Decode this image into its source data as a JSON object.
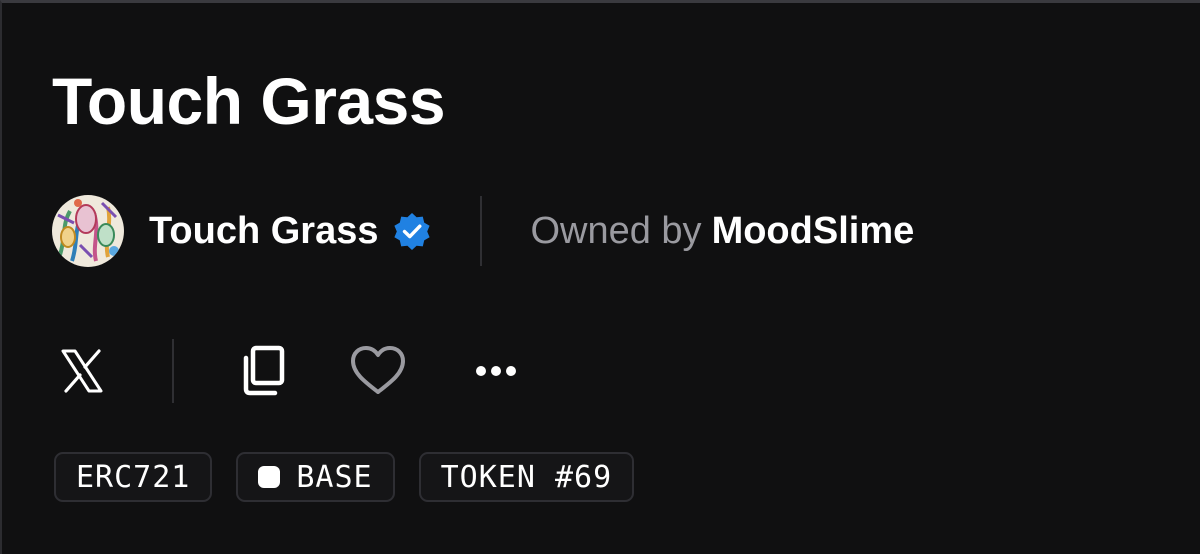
{
  "page": {
    "title": "Touch Grass"
  },
  "collection": {
    "name": "Touch Grass",
    "verified": true,
    "avatar_icon": "collection-avatar-art",
    "verified_icon": "verified-badge-icon",
    "verified_color": "#2081e2"
  },
  "ownership": {
    "prefix": "Owned by",
    "owner": "MoodSlime"
  },
  "actions": [
    {
      "icon": "x-logo-icon"
    },
    {
      "icon": "copy-icon"
    },
    {
      "icon": "heart-icon"
    },
    {
      "icon": "more-icon"
    }
  ],
  "tags": {
    "standard": "ERC721",
    "chain": "BASE",
    "token": "TOKEN #69"
  },
  "colors": {
    "background": "#101011",
    "text": "#ffffff",
    "muted": "#9a9aa0",
    "tag_border": "#2e2e33"
  }
}
